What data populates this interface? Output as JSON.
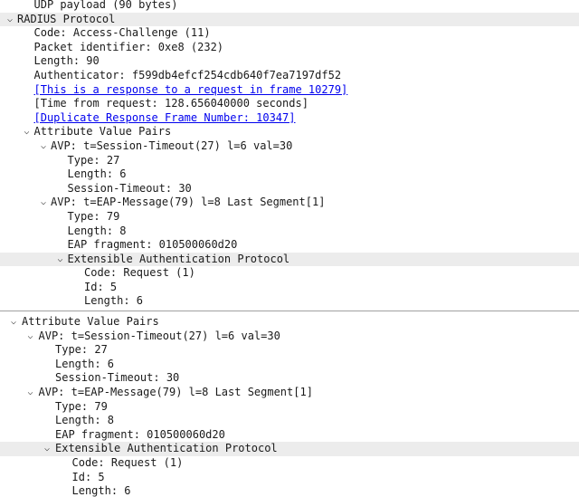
{
  "top_pane": [
    {
      "indent": 1,
      "arrow": null,
      "text": "UDP payload (90 bytes)"
    },
    {
      "indent": 0,
      "arrow": "expanded",
      "text": "RADIUS Protocol",
      "selected": true
    },
    {
      "indent": 1,
      "arrow": null,
      "text": "Code: Access-Challenge (11)"
    },
    {
      "indent": 1,
      "arrow": null,
      "text": "Packet identifier: 0xe8 (232)"
    },
    {
      "indent": 1,
      "arrow": null,
      "text": "Length: 90"
    },
    {
      "indent": 1,
      "arrow": null,
      "text": "Authenticator: f599db4efcf254cdb640f7ea7197df52"
    },
    {
      "indent": 1,
      "arrow": null,
      "text": "[This is a response to a request in frame 10279]",
      "link": true
    },
    {
      "indent": 1,
      "arrow": null,
      "text": "[Time from request: 128.656040000 seconds]"
    },
    {
      "indent": 1,
      "arrow": null,
      "text": "[Duplicate Response Frame Number: 10347]",
      "link": true
    },
    {
      "indent": 1,
      "arrow": "expanded",
      "text": "Attribute Value Pairs"
    },
    {
      "indent": 2,
      "arrow": "expanded",
      "text": "AVP: t=Session-Timeout(27) l=6 val=30"
    },
    {
      "indent": 3,
      "arrow": null,
      "text": "Type: 27"
    },
    {
      "indent": 3,
      "arrow": null,
      "text": "Length: 6"
    },
    {
      "indent": 3,
      "arrow": null,
      "text": "Session-Timeout: 30"
    },
    {
      "indent": 2,
      "arrow": "expanded",
      "text": "AVP: t=EAP-Message(79) l=8 Last Segment[1]"
    },
    {
      "indent": 3,
      "arrow": null,
      "text": "Type: 79"
    },
    {
      "indent": 3,
      "arrow": null,
      "text": "Length: 8"
    },
    {
      "indent": 3,
      "arrow": null,
      "text": "EAP fragment: 010500060d20"
    },
    {
      "indent": 3,
      "arrow": "expanded",
      "text": "Extensible Authentication Protocol",
      "selected": true
    },
    {
      "indent": 4,
      "arrow": null,
      "text": "Code: Request (1)"
    },
    {
      "indent": 4,
      "arrow": null,
      "text": "Id: 5"
    },
    {
      "indent": 4,
      "arrow": null,
      "text": "Length: 6"
    }
  ],
  "bottom_pane": [
    {
      "indent": 0,
      "arrow": "expanded",
      "text": "Attribute Value Pairs"
    },
    {
      "indent": 1,
      "arrow": "expanded",
      "text": "AVP: t=Session-Timeout(27) l=6 val=30"
    },
    {
      "indent": 2,
      "arrow": null,
      "text": "Type: 27"
    },
    {
      "indent": 2,
      "arrow": null,
      "text": "Length: 6"
    },
    {
      "indent": 2,
      "arrow": null,
      "text": "Session-Timeout: 30"
    },
    {
      "indent": 1,
      "arrow": "expanded",
      "text": "AVP: t=EAP-Message(79) l=8 Last Segment[1]"
    },
    {
      "indent": 2,
      "arrow": null,
      "text": "Type: 79"
    },
    {
      "indent": 2,
      "arrow": null,
      "text": "Length: 8"
    },
    {
      "indent": 2,
      "arrow": null,
      "text": "EAP fragment: 010500060d20"
    },
    {
      "indent": 2,
      "arrow": "expanded",
      "text": "Extensible Authentication Protocol",
      "selected": true
    },
    {
      "indent": 3,
      "arrow": null,
      "text": "Code: Request (1)"
    },
    {
      "indent": 3,
      "arrow": null,
      "text": "Id: 5"
    },
    {
      "indent": 3,
      "arrow": null,
      "text": "Length: 6"
    }
  ]
}
